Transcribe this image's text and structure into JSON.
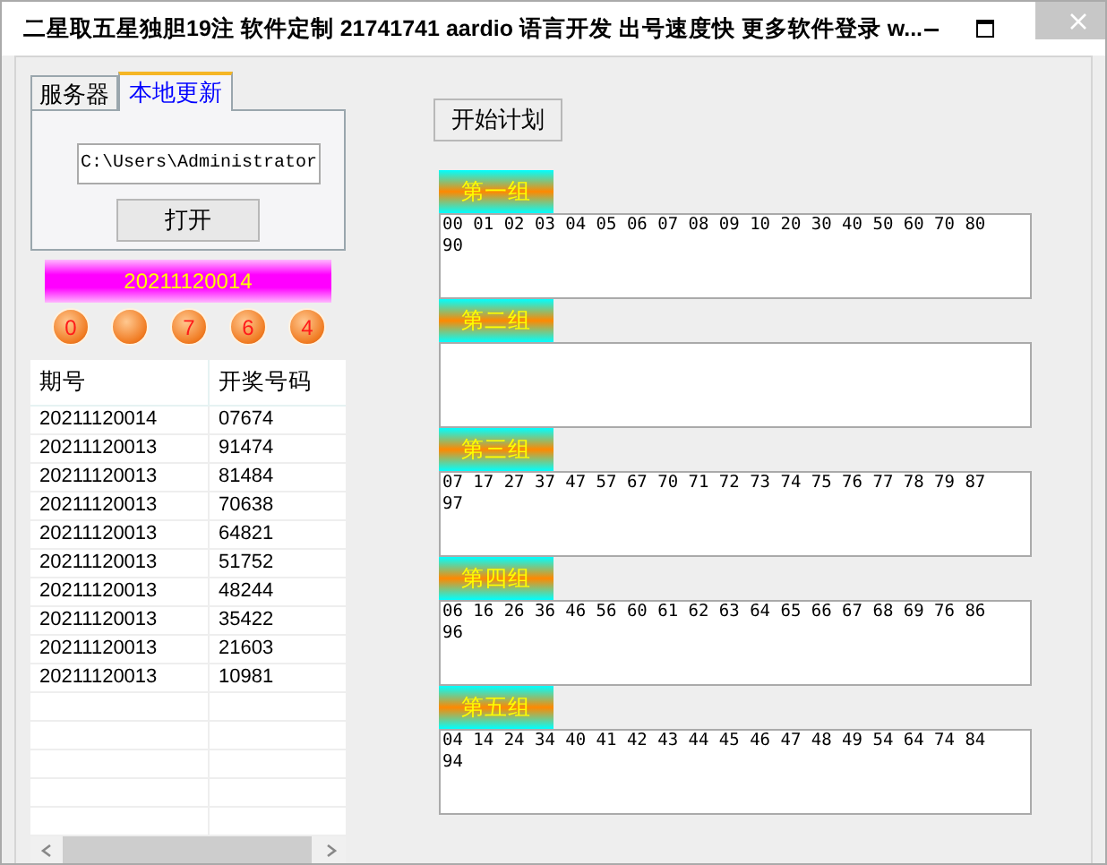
{
  "window": {
    "title": "二星取五星独胆19注 软件定制 21741741 aardio 语言开发 出号速度快 更多软件登录 w..."
  },
  "tabs": [
    {
      "label": "服务器",
      "selected": false
    },
    {
      "label": "本地更新",
      "selected": true
    }
  ],
  "path_field": {
    "value": "C:\\Users\\Administrator"
  },
  "open_button": "打开",
  "issue_banner": "20211120014",
  "balls": [
    {
      "kind": "digit",
      "label": "0"
    },
    {
      "kind": "blank"
    },
    {
      "kind": "digit",
      "label": "7"
    },
    {
      "kind": "digit",
      "label": "6"
    },
    {
      "kind": "digit",
      "label": "4"
    }
  ],
  "table": {
    "columns": [
      "期号",
      "开奖号码"
    ],
    "rows": [
      [
        "20211120014",
        "07674"
      ],
      [
        "20211120013",
        "91474"
      ],
      [
        "20211120013",
        "81484"
      ],
      [
        "20211120013",
        "70638"
      ],
      [
        "20211120013",
        "64821"
      ],
      [
        "20211120013",
        "51752"
      ],
      [
        "20211120013",
        "48244"
      ],
      [
        "20211120013",
        "35422"
      ],
      [
        "20211120013",
        "21603"
      ],
      [
        "20211120013",
        "10981"
      ]
    ]
  },
  "start_button": "开始计划",
  "groups": [
    {
      "title": "第一组",
      "numbers": "00 01 02 03 04 05 06 07 08 09 10 20 30 40 50 60 70 80 90"
    },
    {
      "title": "第二组"
    },
    {
      "title": "第三组",
      "numbers": "07 17 27 37 47 57 67 70 71 72 73 74 75 76 77 78 79 87 97"
    },
    {
      "title": "第四组",
      "numbers": "06 16 26 36 46 56 60 61 62 63 64 65 66 67 68 69 76 86 96"
    },
    {
      "title": "第五组",
      "numbers": "04 14 24 34 40 41 42 43 44 45 46 47 48 49 54 64 74 84 94"
    }
  ]
}
